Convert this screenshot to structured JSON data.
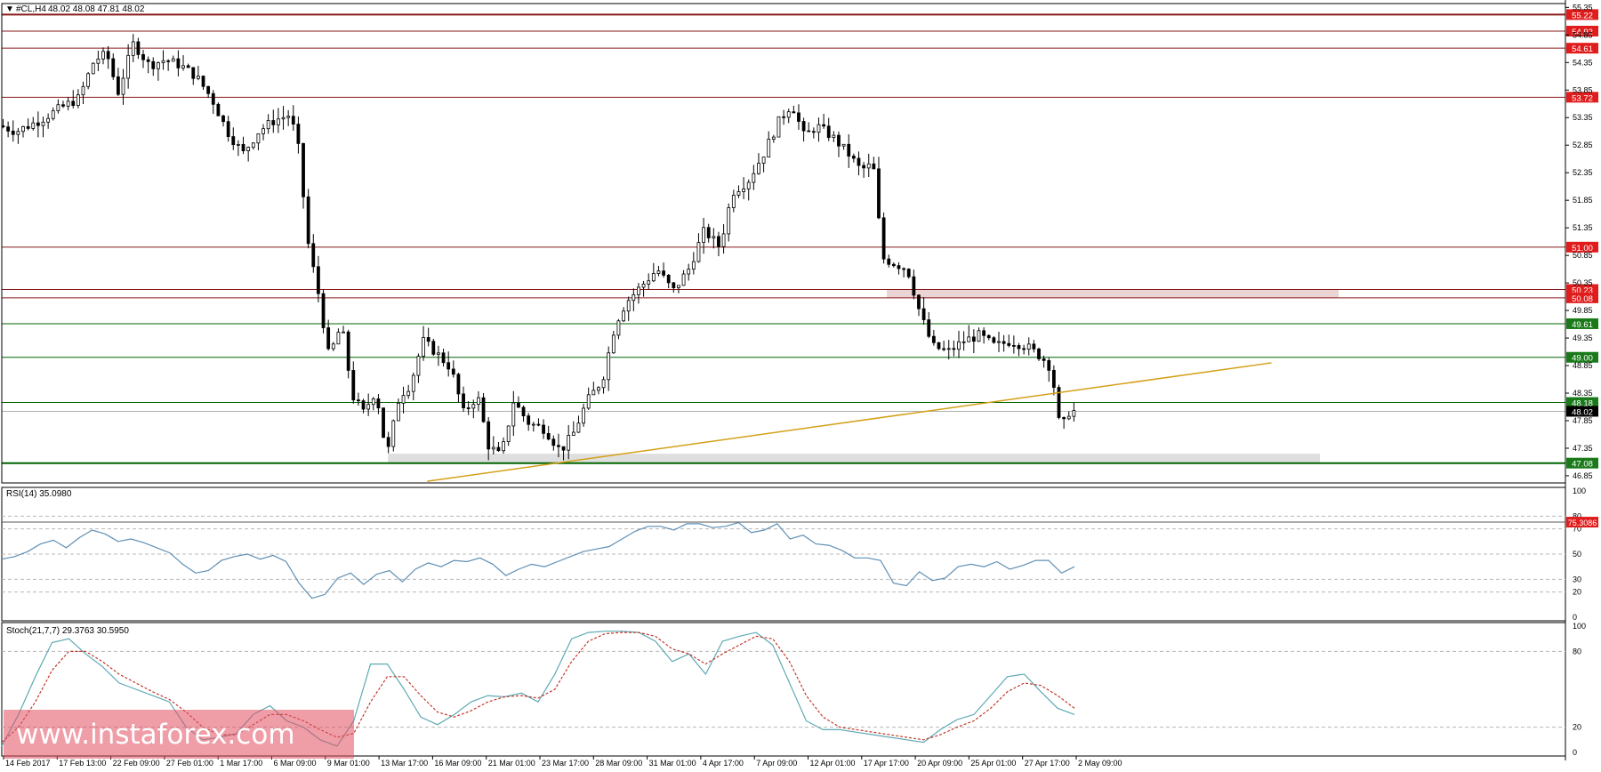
{
  "header": {
    "symbol_label": "#CL,H4",
    "ohlc": "48.02 48.08 47.81 48.02"
  },
  "watermark": "www.instaforex.com",
  "colors": {
    "candle_up": "#000000",
    "candle_down": "#000000",
    "resistance_line": "#8b1a1a",
    "support_line": "#006400",
    "trendline": "#d4a017",
    "zone": "#e9cfcf",
    "zone_gray": "#dcdcdc",
    "rsi_line": "#5f8fb4",
    "stoch_main": "#5fa9b4",
    "stoch_signal": "#c0392b",
    "price_tag_red": "#e01c1c",
    "price_tag_green": "#1a7a1a",
    "price_tag_black": "#000000"
  },
  "chart_data": [
    {
      "type": "candlestick",
      "title": "#CL,H4",
      "x_ticks": [
        "14 Feb 2017",
        "17 Feb 13:00",
        "22 Feb 09:00",
        "27 Feb 01:00",
        "1 Mar 17:00",
        "6 Mar 09:00",
        "9 Mar 01:00",
        "13 Mar 17:00",
        "16 Mar 09:00",
        "21 Mar 01:00",
        "23 Mar 17:00",
        "28 Mar 09:00",
        "31 Mar 01:00",
        "4 Apr 17:00",
        "7 Apr 09:00",
        "12 Apr 01:00",
        "17 Apr 17:00",
        "20 Apr 09:00",
        "25 Apr 01:00",
        "27 Apr 17:00",
        "2 May 09:00"
      ],
      "y_ticks": [
        "55.35",
        "54.85",
        "54.35",
        "53.85",
        "53.35",
        "52.85",
        "52.35",
        "51.85",
        "51.35",
        "50.85",
        "50.35",
        "49.85",
        "49.35",
        "48.85",
        "48.35",
        "47.85",
        "47.35",
        "46.85"
      ],
      "ylim": [
        46.72,
        55.42
      ],
      "horizontal_levels": [
        {
          "value": 55.22,
          "label": "55.22",
          "kind": "resistance",
          "tag": "red"
        },
        {
          "value": 54.92,
          "label": "54.92",
          "kind": "resistance",
          "tag": "red"
        },
        {
          "value": 54.61,
          "label": "54.61",
          "kind": "resistance",
          "tag": "red"
        },
        {
          "value": 53.72,
          "label": "53.72",
          "kind": "resistance",
          "tag": "red"
        },
        {
          "value": 51.0,
          "label": "51.00",
          "kind": "resistance",
          "tag": "red"
        },
        {
          "value": 50.23,
          "label": "50.23",
          "kind": "resistance",
          "tag": "red"
        },
        {
          "value": 50.08,
          "label": "50.08",
          "kind": "resistance",
          "tag": "red"
        },
        {
          "value": 49.61,
          "label": "49.61",
          "kind": "support",
          "tag": "green"
        },
        {
          "value": 49.0,
          "label": "49.00",
          "kind": "support",
          "tag": "green"
        },
        {
          "value": 48.18,
          "label": "48.18",
          "kind": "support",
          "tag": "green"
        },
        {
          "value": 47.08,
          "label": "47.08",
          "kind": "support",
          "tag": "green"
        }
      ],
      "current_price": {
        "value": 48.02,
        "label": "48.02"
      },
      "zones": [
        {
          "x_start": 0.566,
          "x_end": 0.855,
          "y_low": 50.08,
          "y_high": 50.23,
          "color": "pink"
        },
        {
          "x_start": 0.247,
          "x_end": 0.843,
          "y_low": 47.08,
          "y_high": 47.25,
          "color": "gray"
        }
      ],
      "trendline": {
        "x1": 0.272,
        "y1": 46.75,
        "x2": 0.812,
        "y2": 48.9
      },
      "path": [
        [
          0.0,
          53.2
        ],
        [
          0.01,
          53.1
        ],
        [
          0.025,
          53.3
        ],
        [
          0.04,
          53.55
        ],
        [
          0.05,
          53.7
        ],
        [
          0.06,
          54.4
        ],
        [
          0.068,
          54.5
        ],
        [
          0.075,
          53.8
        ],
        [
          0.085,
          54.7
        ],
        [
          0.095,
          54.3
        ],
        [
          0.105,
          54.4
        ],
        [
          0.115,
          54.3
        ],
        [
          0.125,
          54.1
        ],
        [
          0.135,
          53.7
        ],
        [
          0.145,
          53.1
        ],
        [
          0.155,
          52.7
        ],
        [
          0.165,
          53.1
        ],
        [
          0.175,
          53.3
        ],
        [
          0.185,
          53.4
        ],
        [
          0.19,
          52.9
        ],
        [
          0.197,
          51.0
        ],
        [
          0.203,
          50.2
        ],
        [
          0.21,
          49.0
        ],
        [
          0.218,
          49.6
        ],
        [
          0.225,
          48.3
        ],
        [
          0.232,
          48.0
        ],
        [
          0.24,
          48.4
        ],
        [
          0.247,
          47.2
        ],
        [
          0.255,
          48.3
        ],
        [
          0.262,
          48.5
        ],
        [
          0.27,
          49.3
        ],
        [
          0.278,
          49.1
        ],
        [
          0.288,
          48.8
        ],
        [
          0.296,
          48.0
        ],
        [
          0.305,
          48.3
        ],
        [
          0.312,
          47.4
        ],
        [
          0.32,
          47.2
        ],
        [
          0.328,
          48.2
        ],
        [
          0.338,
          47.8
        ],
        [
          0.348,
          47.7
        ],
        [
          0.358,
          47.3
        ],
        [
          0.366,
          47.6
        ],
        [
          0.375,
          48.2
        ],
        [
          0.385,
          48.6
        ],
        [
          0.393,
          49.6
        ],
        [
          0.4,
          50.0
        ],
        [
          0.41,
          50.3
        ],
        [
          0.42,
          50.6
        ],
        [
          0.43,
          50.2
        ],
        [
          0.44,
          50.6
        ],
        [
          0.45,
          51.3
        ],
        [
          0.46,
          51.0
        ],
        [
          0.468,
          52.0
        ],
        [
          0.478,
          52.2
        ],
        [
          0.488,
          52.7
        ],
        [
          0.498,
          53.3
        ],
        [
          0.506,
          53.6
        ],
        [
          0.514,
          53.0
        ],
        [
          0.522,
          53.2
        ],
        [
          0.532,
          53.0
        ],
        [
          0.542,
          52.7
        ],
        [
          0.55,
          52.4
        ],
        [
          0.558,
          52.5
        ],
        [
          0.564,
          50.8
        ],
        [
          0.572,
          50.7
        ],
        [
          0.58,
          50.6
        ],
        [
          0.588,
          49.8
        ],
        [
          0.596,
          49.2
        ],
        [
          0.606,
          49.1
        ],
        [
          0.616,
          49.3
        ],
        [
          0.626,
          49.4
        ],
        [
          0.636,
          49.2
        ],
        [
          0.646,
          49.3
        ],
        [
          0.656,
          49.2
        ],
        [
          0.666,
          49.0
        ],
        [
          0.672,
          48.8
        ],
        [
          0.678,
          47.6
        ],
        [
          0.682,
          48.0
        ],
        [
          0.686,
          48.02
        ]
      ]
    },
    {
      "type": "line",
      "title": "RSI(14) 35.0980",
      "y_ticks": [
        "100",
        "80",
        "70",
        "50",
        "30",
        "20",
        "0"
      ],
      "ylim": [
        0,
        100
      ],
      "reference_level": {
        "value": 75.3086,
        "label": "75.3086"
      },
      "series": [
        {
          "values": [
            46,
            48,
            52,
            58,
            61,
            55,
            63,
            69,
            66,
            60,
            62,
            59,
            55,
            51,
            42,
            35,
            37,
            45,
            48,
            50,
            46,
            49,
            44,
            27,
            15,
            18,
            31,
            35,
            26,
            34,
            37,
            28,
            38,
            43,
            40,
            45,
            44,
            47,
            42,
            33,
            38,
            42,
            40,
            44,
            48,
            52,
            54,
            56,
            62,
            68,
            72,
            72,
            69,
            74,
            74,
            71,
            72,
            75,
            67,
            69,
            74,
            62,
            65,
            58,
            57,
            53,
            47,
            47,
            45,
            27,
            25,
            36,
            29,
            31,
            40,
            42,
            40,
            44,
            38,
            41,
            45,
            45,
            35,
            40
          ]
        }
      ]
    },
    {
      "type": "line",
      "title": "Stoch(21,7,7) 29.3763 30.5950",
      "y_ticks": [
        "100",
        "80",
        "20",
        "0"
      ],
      "ylim": [
        0,
        100
      ],
      "series": [
        {
          "values": [
            5,
            30,
            60,
            87,
            90,
            78,
            68,
            55,
            50,
            45,
            40,
            20,
            10,
            12,
            15,
            30,
            37,
            25,
            20,
            10,
            5,
            25,
            70,
            70,
            50,
            28,
            22,
            30,
            40,
            45,
            44,
            47,
            40,
            62,
            90,
            95,
            96,
            96,
            95,
            88,
            72,
            78,
            62,
            88,
            92,
            95,
            85,
            55,
            25,
            18,
            18,
            16,
            14,
            12,
            10,
            8,
            18,
            26,
            30,
            45,
            60,
            62,
            48,
            35,
            30
          ]
        },
        {
          "values": [
            8,
            20,
            40,
            65,
            80,
            80,
            72,
            62,
            55,
            48,
            42,
            32,
            20,
            14,
            14,
            22,
            30,
            30,
            25,
            18,
            12,
            15,
            40,
            60,
            60,
            45,
            32,
            28,
            33,
            40,
            44,
            45,
            43,
            50,
            72,
            88,
            94,
            95,
            95,
            92,
            82,
            78,
            70,
            78,
            85,
            92,
            90,
            72,
            45,
            28,
            20,
            18,
            16,
            14,
            12,
            10,
            14,
            20,
            25,
            35,
            48,
            55,
            53,
            45,
            35
          ]
        }
      ]
    }
  ]
}
